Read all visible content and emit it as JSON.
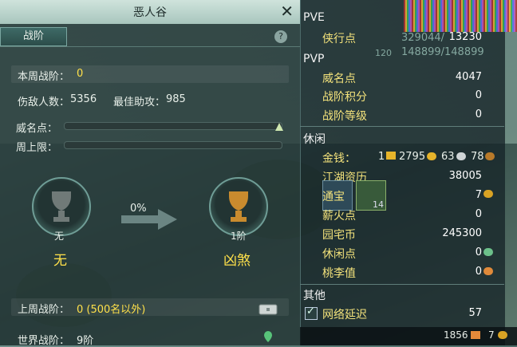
{
  "window": {
    "title": "恶人谷",
    "tab": "战阶",
    "help_glyph": "?",
    "close_glyph": "✕"
  },
  "left": {
    "weekly_rank_label": "本周战阶：",
    "weekly_rank_value": "0",
    "kills_label": "伤敌人数：",
    "kills_value": "5356",
    "assist_label": "最佳助攻：",
    "assist_value": "985",
    "prestige_label": "威名点：",
    "cap_label": "周上限：",
    "prestige_progress": 0.0,
    "cap_progress": 0.0,
    "current_badge_small": "无",
    "current_badge_big": "无",
    "progress_percent": "0%",
    "next_badge_small": "1阶",
    "next_badge_big": "凶煞",
    "last_week_label": "上周战阶：",
    "last_week_value": "0 (500名以外)",
    "world_label": "世界战阶：",
    "world_value": "9阶"
  },
  "right": {
    "pve": "PVE",
    "pvp": "PVP",
    "leisure": "休闲",
    "other": "其他",
    "rows": {
      "xiaxing": {
        "label": "侠行点",
        "value": "13230"
      },
      "weiming": {
        "label": "威名点",
        "value": "4047"
      },
      "zhanjie_jifen": {
        "label": "战阶积分",
        "value": "0"
      },
      "zhanjie_dengji": {
        "label": "战阶等级",
        "value": "0"
      },
      "jinqian": {
        "label": "金钱：",
        "value1": "1",
        "value2": "2795",
        "value3": "63",
        "value4": "78"
      },
      "jianghu": {
        "label": "江湖资历",
        "value": "38005"
      },
      "tongbao": {
        "label": "通宝",
        "value": "7"
      },
      "xinhuo": {
        "label": "薪火点",
        "value": "0"
      },
      "yuanzhai": {
        "label": "园宅币",
        "value": "245300"
      },
      "xiuxian": {
        "label": "休闲点",
        "value": "0"
      },
      "taoli": {
        "label": "桃李值",
        "value": "0"
      },
      "latency": {
        "label": "网络延迟",
        "value": "57"
      }
    },
    "bottom_left": "1856",
    "bottom_right": "7",
    "ghost_top": "329044/",
    "ghost_top2": "148899/148899",
    "ghost_lv": "120",
    "ghost_14": "14"
  },
  "colors": {
    "accent_yellow": "#ffe14a",
    "label_yellow": "#f3e27b",
    "panel": "#22343f"
  }
}
